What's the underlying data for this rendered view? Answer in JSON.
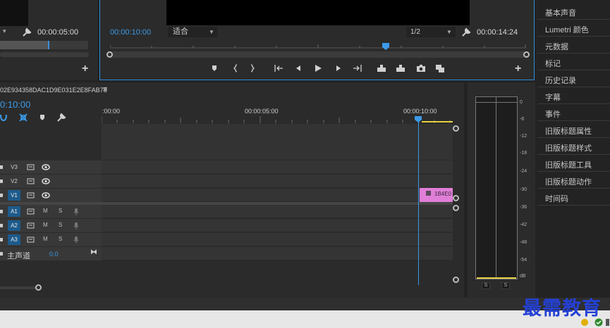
{
  "source_monitor": {
    "timecode": "00:00:05:00"
  },
  "program_monitor": {
    "timecode": "00:00:10:00",
    "fit_value": "适合",
    "resolution": "1/2",
    "duration": "00:00:14:24"
  },
  "panels_menu": {
    "items": [
      "基本声音",
      "Lumetri 颜色",
      "元数据",
      "标记",
      "历史记录",
      "字幕",
      "事件",
      "旧版标题属性",
      "旧版标题样式",
      "旧版标题工具",
      "旧版标题动作",
      "时间码"
    ]
  },
  "timeline": {
    "sequence_name": "02E934358DAC1D9E031E2E8FAB78",
    "timecode": "0:10:00",
    "ruler_labels": [
      ":00:00",
      "00:00:05:00",
      "00:00:10:00"
    ],
    "video_tracks": [
      {
        "label": "V3",
        "active": false
      },
      {
        "label": "V2",
        "active": false
      },
      {
        "label": "V1",
        "active": true
      }
    ],
    "audio_tracks": [
      {
        "label": "A1",
        "mute": "M",
        "solo": "S"
      },
      {
        "label": "A2",
        "mute": "M",
        "solo": "S"
      },
      {
        "label": "A3",
        "mute": "M",
        "solo": "S"
      }
    ],
    "master": {
      "label": "主声道",
      "value": "0.0"
    },
    "clip": {
      "label": "1B4E0",
      "color": "#e07ed8"
    },
    "accent": "#3b9ae8"
  },
  "audio_meter": {
    "scale": [
      "0",
      "-6",
      "-12",
      "-18",
      "-24",
      "-30",
      "-36",
      "-42",
      "-48",
      "-54",
      "dB"
    ],
    "solo_buttons": [
      "S",
      "S"
    ]
  },
  "watermark": {
    "text": "最需教育"
  }
}
